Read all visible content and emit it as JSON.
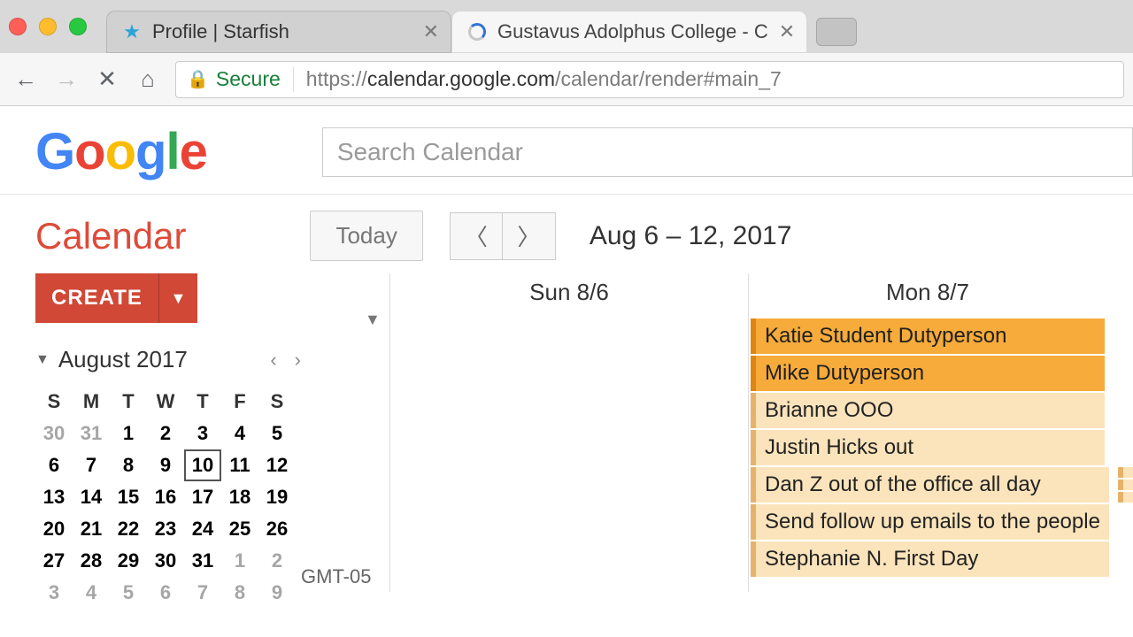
{
  "browser": {
    "tabs": [
      {
        "title": "Profile | Starfish"
      },
      {
        "title": "Gustavus Adolphus College - C"
      }
    ],
    "secure_label": "Secure",
    "url_prefix": "https://",
    "url_host": "calendar.google.com",
    "url_path": "/calendar/render#main_7"
  },
  "header": {
    "search_placeholder": "Search Calendar"
  },
  "toolbar": {
    "app_title": "Calendar",
    "today_label": "Today",
    "date_range": "Aug 6 – 12, 2017"
  },
  "sidebar": {
    "create_label": "CREATE",
    "month_label": "August 2017",
    "dow": [
      "S",
      "M",
      "T",
      "W",
      "T",
      "F",
      "S"
    ],
    "weeks": [
      [
        {
          "n": "30",
          "cls": "other"
        },
        {
          "n": "31",
          "cls": "other"
        },
        {
          "n": "1"
        },
        {
          "n": "2"
        },
        {
          "n": "3"
        },
        {
          "n": "4"
        },
        {
          "n": "5"
        }
      ],
      [
        {
          "n": "6",
          "cls": "thin"
        },
        {
          "n": "7"
        },
        {
          "n": "8"
        },
        {
          "n": "9"
        },
        {
          "n": "10",
          "cls": "today"
        },
        {
          "n": "11"
        },
        {
          "n": "12"
        }
      ],
      [
        {
          "n": "13",
          "cls": "thin"
        },
        {
          "n": "14"
        },
        {
          "n": "15"
        },
        {
          "n": "16"
        },
        {
          "n": "17"
        },
        {
          "n": "18"
        },
        {
          "n": "19"
        }
      ],
      [
        {
          "n": "20",
          "cls": "thin"
        },
        {
          "n": "21"
        },
        {
          "n": "22"
        },
        {
          "n": "23"
        },
        {
          "n": "24"
        },
        {
          "n": "25"
        },
        {
          "n": "26"
        }
      ],
      [
        {
          "n": "27",
          "cls": "thin"
        },
        {
          "n": "28"
        },
        {
          "n": "29"
        },
        {
          "n": "30"
        },
        {
          "n": "31"
        },
        {
          "n": "1",
          "cls": "other"
        },
        {
          "n": "2",
          "cls": "other"
        }
      ],
      [
        {
          "n": "3",
          "cls": "other"
        },
        {
          "n": "4",
          "cls": "other"
        },
        {
          "n": "5",
          "cls": "other"
        },
        {
          "n": "6",
          "cls": "other"
        },
        {
          "n": "7",
          "cls": "other"
        },
        {
          "n": "8",
          "cls": "other"
        },
        {
          "n": "9",
          "cls": "other"
        }
      ]
    ]
  },
  "calendar": {
    "tz_label": "GMT-05",
    "days": [
      {
        "label": "Sun 8/6",
        "events": [],
        "narrow": []
      },
      {
        "label": "Mon 8/7",
        "events": [
          {
            "text": "Katie Student Dutyperson",
            "tone": "dark"
          },
          {
            "text": "Mike Dutyperson",
            "tone": "dark"
          },
          {
            "text": "Brianne OOO",
            "tone": "light"
          },
          {
            "text": "Justin Hicks out",
            "tone": "light"
          },
          {
            "text": "Dan Z out of the office all day",
            "tone": "light"
          },
          {
            "text": "Send follow up emails to the people",
            "tone": "light"
          },
          {
            "text": "Stephanie N. First Day",
            "tone": "light"
          }
        ],
        "narrow": [
          {
            "text": "",
            "tone": "light",
            "from": 4
          }
        ]
      }
    ]
  }
}
